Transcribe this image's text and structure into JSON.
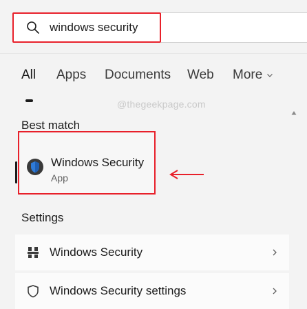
{
  "search": {
    "value": "windows security",
    "icon": "search-icon",
    "highlight_color": "#e8202a"
  },
  "tabs": [
    {
      "label": "All",
      "active": true
    },
    {
      "label": "Apps"
    },
    {
      "label": "Documents"
    },
    {
      "label": "Web"
    },
    {
      "label": "More"
    }
  ],
  "watermark": "@thegeekpage.com",
  "best_match": {
    "section_title": "Best match",
    "app_name": "Windows Security",
    "app_type": "App",
    "icon": "windows-security-shield-icon",
    "annotation_color": "#e8202a"
  },
  "settings": {
    "section_title": "Settings",
    "items": [
      {
        "label": "Windows Security",
        "icon": "windows-security-settings-icon"
      },
      {
        "label": "Windows Security settings",
        "icon": "shield-outline-icon"
      }
    ]
  }
}
